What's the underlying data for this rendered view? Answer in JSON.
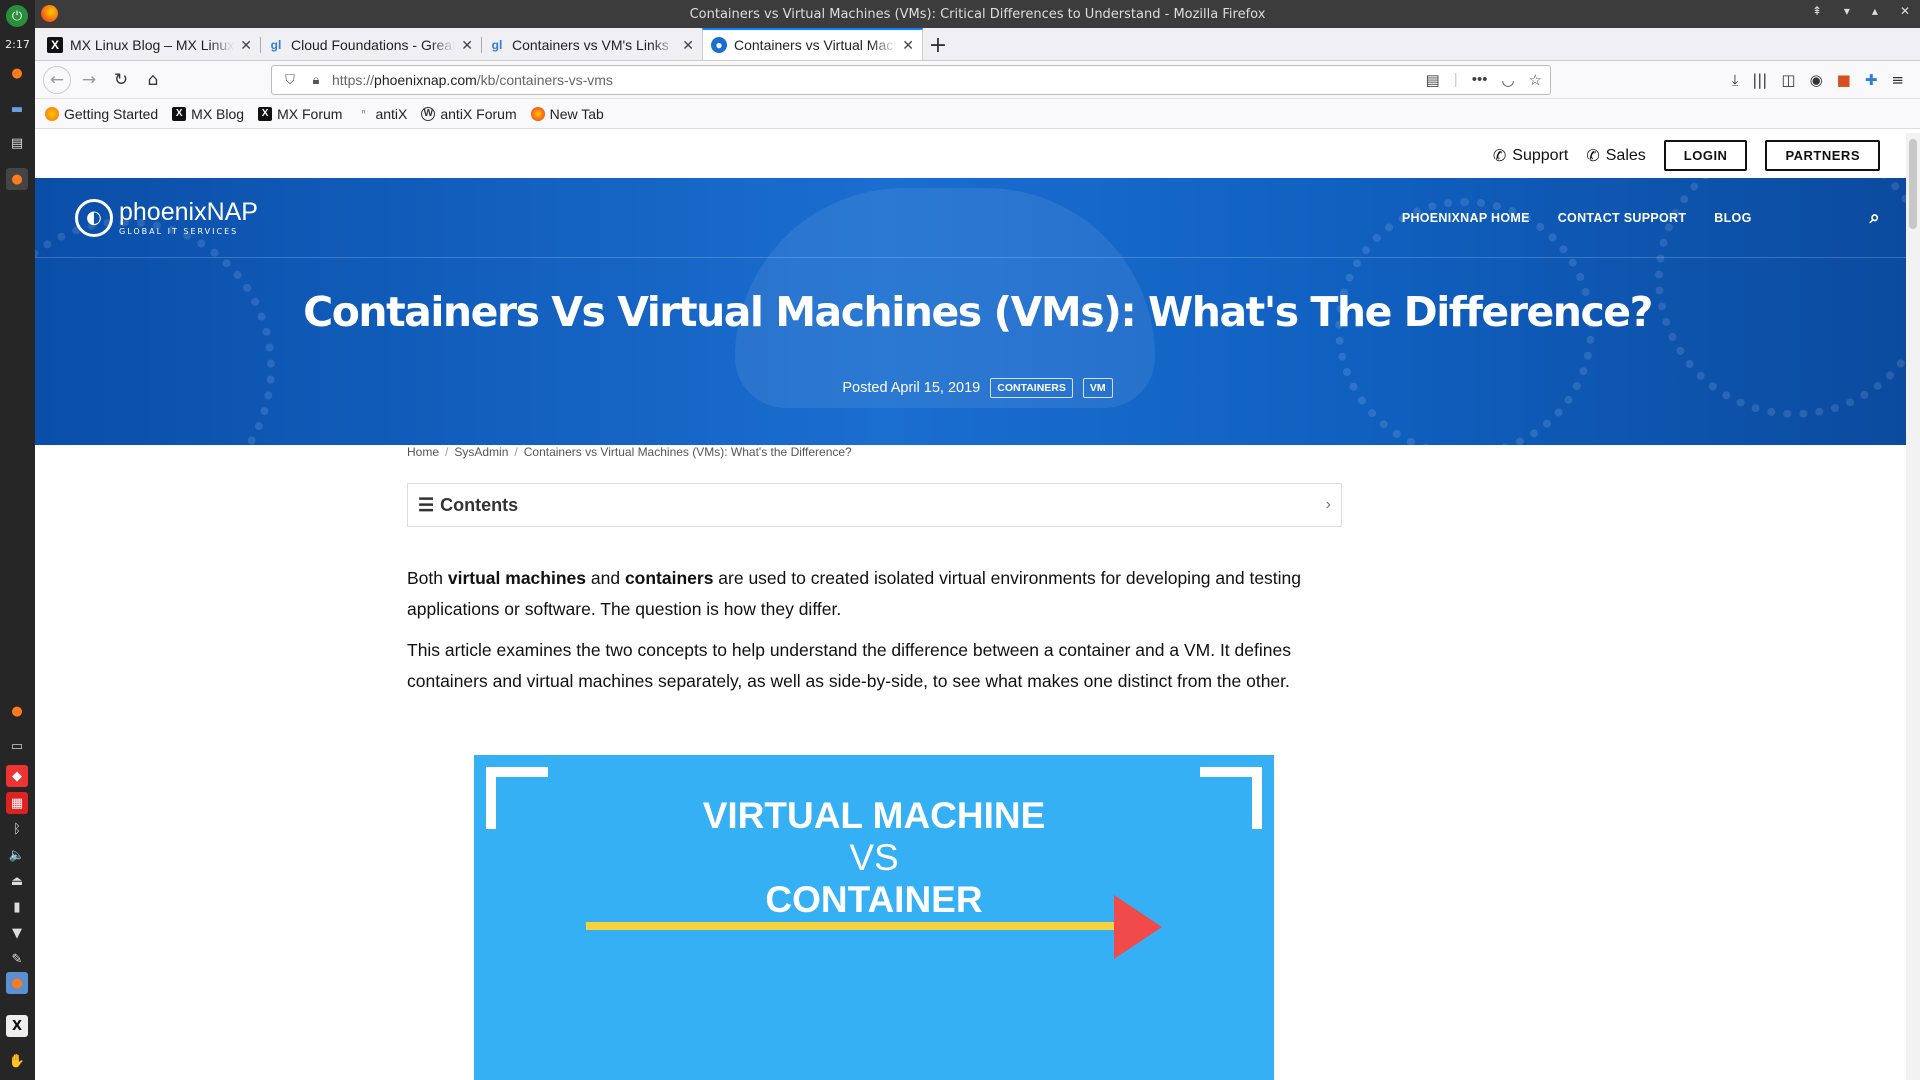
{
  "desktop": {
    "clock": "2:17"
  },
  "window": {
    "title": "Containers vs Virtual Machines (VMs): Critical Differences to Understand - Mozilla Firefox"
  },
  "tabs": [
    {
      "label": "MX Linux Blog – MX Linux",
      "icon": "mx-icon"
    },
    {
      "label": "Cloud Foundations - Great Learning",
      "icon": "greatlearning-icon"
    },
    {
      "label": "Containers vs VM's Links",
      "icon": "greatlearning-icon"
    },
    {
      "label": "Containers vs Virtual Machines",
      "icon": "phoenixnap-icon"
    }
  ],
  "url": {
    "prefix": "https://",
    "domain": "phoenixnap.com",
    "path": "/kb/containers-vs-vms"
  },
  "bookmarks": [
    {
      "label": "Getting Started"
    },
    {
      "label": "MX Blog"
    },
    {
      "label": "MX Forum"
    },
    {
      "label": "antiX"
    },
    {
      "label": "antiX Forum"
    },
    {
      "label": "New Tab"
    }
  ],
  "site": {
    "support": "Support",
    "sales": "Sales",
    "login": "LOGIN",
    "partners": "PARTNERS",
    "logo_name": "phoenixNAP",
    "logo_sub": "GLOBAL IT SERVICES",
    "menu": [
      "PHOENIXNAP HOME",
      "CONTACT SUPPORT",
      "BLOG"
    ]
  },
  "article": {
    "title": "Containers Vs Virtual Machines (VMs): What's The Difference?",
    "posted": "Posted April 15, 2019",
    "tags": [
      "CONTAINERS",
      "VM"
    ],
    "breadcrumb": [
      "Home",
      "SysAdmin",
      "Containers vs Virtual Machines (VMs): What's the Difference?"
    ],
    "contents_label": "Contents",
    "p1": {
      "a": "Both ",
      "b1": "virtual machines",
      "c": " and ",
      "b2": "containers",
      "d": " are used to created isolated virtual environments for developing and testing applications or software. The question is how they differ."
    },
    "p2": "This article examines the two concepts to help understand the difference between a container and a VM. It defines containers and virtual machines separately, as well as side-by-side, to see what makes one distinct from the other.",
    "infographic": {
      "line1": "VIRTUAL MACHINE",
      "line2": "VS",
      "line3": "CONTAINER"
    }
  },
  "colors": {
    "accent_tab": "#0a84ff",
    "hero_blue": "#1a6ed0",
    "infographic_bg": "#36b0f5",
    "arrow_yellow": "#f7d33b",
    "arrow_red": "#f04a4a"
  }
}
